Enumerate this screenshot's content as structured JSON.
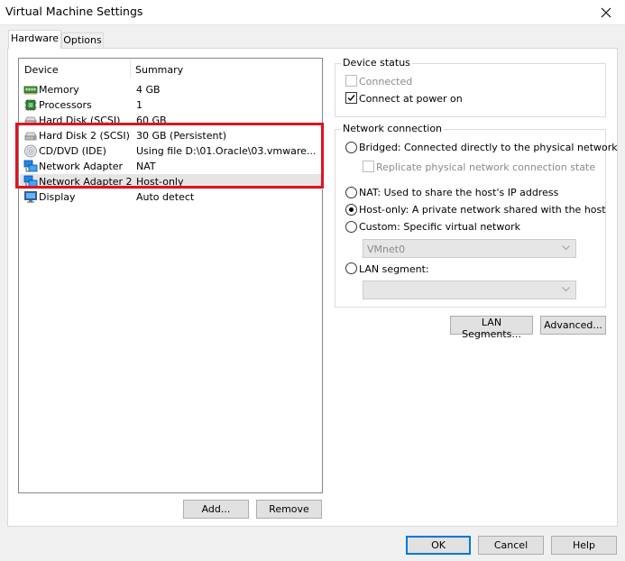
{
  "window": {
    "title": "Virtual Machine Settings"
  },
  "tabs": [
    {
      "label": "Hardware",
      "active": true
    },
    {
      "label": "Options",
      "active": false
    }
  ],
  "device_list": {
    "headers": {
      "device": "Device",
      "summary": "Summary"
    },
    "rows": [
      {
        "icon": "memory-icon",
        "name": "Memory",
        "summary": "4 GB"
      },
      {
        "icon": "processor-icon",
        "name": "Processors",
        "summary": "1"
      },
      {
        "icon": "hard-disk-icon",
        "name": "Hard Disk (SCSI)",
        "summary": "60 GB"
      },
      {
        "icon": "hard-disk-icon",
        "name": "Hard Disk 2 (SCSI)",
        "summary": "30 GB (Persistent)"
      },
      {
        "icon": "cd-dvd-icon",
        "name": "CD/DVD (IDE)",
        "summary": "Using file D:\\01.Oracle\\03.vmware..."
      },
      {
        "icon": "network-adapter-icon",
        "name": "Network Adapter",
        "summary": "NAT"
      },
      {
        "icon": "network-adapter-icon",
        "name": "Network Adapter 2",
        "summary": "Host-only",
        "selected": true
      },
      {
        "icon": "display-icon",
        "name": "Display",
        "summary": "Auto detect"
      }
    ],
    "add_button": "Add...",
    "remove_button": "Remove"
  },
  "device_status": {
    "title": "Device status",
    "connected": {
      "label": "Connected",
      "checked": false,
      "enabled": false
    },
    "connect_at_power_on": {
      "label": "Connect at power on",
      "checked": true,
      "enabled": true
    }
  },
  "network_connection": {
    "title": "Network connection",
    "bridged": "Bridged: Connected directly to the physical network",
    "replicate": "Replicate physical network connection state",
    "nat": "NAT: Used to share the host's IP address",
    "host_only": "Host-only: A private network shared with the host",
    "custom": "Custom: Specific virtual network",
    "custom_select_value": "VMnet0",
    "lan_segment": "LAN segment:",
    "lan_segment_select_value": "",
    "selected": "host_only"
  },
  "buttons": {
    "lan_segments": "LAN Segments...",
    "advanced": "Advanced...",
    "ok": "OK",
    "cancel": "Cancel",
    "help": "Help"
  },
  "colors": {
    "highlight_box": "#e0141e",
    "selection": "#e5e5e5",
    "default_button_border": "#0078d7"
  }
}
